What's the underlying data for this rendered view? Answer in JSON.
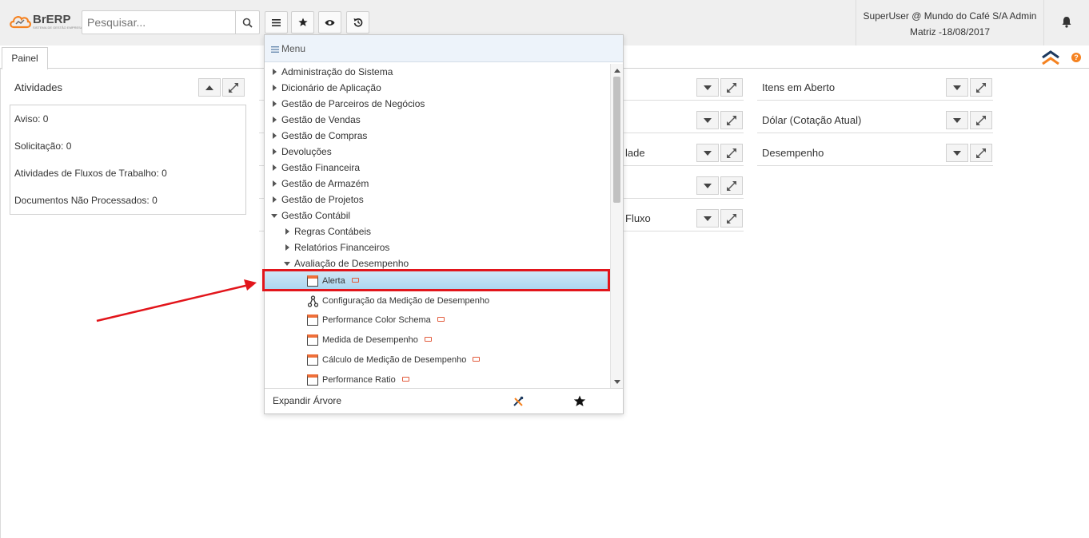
{
  "app": {
    "logo_text": "BrERP",
    "logo_subtitle": "SISTEMA DE GESTÃO EMPRESARIAL",
    "brand_color": "#f58220"
  },
  "search": {
    "placeholder": "Pesquisar..."
  },
  "toolbar": {
    "buttons": [
      {
        "icon": "menu-icon"
      },
      {
        "icon": "star-icon"
      },
      {
        "icon": "eye-icon"
      },
      {
        "icon": "history-icon"
      }
    ]
  },
  "user": {
    "line1": "SuperUser @ Mundo do Café S/A Admin",
    "line2": "Matriz -18/08/2017"
  },
  "tabs": [
    {
      "label": "Painel"
    }
  ],
  "dashboard": {
    "activities": {
      "title": "Atividades",
      "items": [
        "Aviso: 0",
        "Solicitação: 0",
        "Atividades de Fluxos de Trabalho: 0",
        "Documentos Não Processados: 0"
      ]
    },
    "middle_partial": [
      "lade",
      "Fluxo"
    ],
    "right_panels": [
      "Itens em Aberto",
      "Dólar (Cotação Atual)",
      "Desempenho"
    ]
  },
  "menu": {
    "header": "Menu",
    "tree": [
      {
        "label": "Administração do Sistema",
        "level": 0,
        "expanded": false
      },
      {
        "label": "Dicionário de Aplicação",
        "level": 0,
        "expanded": false
      },
      {
        "label": "Gestão de Parceiros de Negócios",
        "level": 0,
        "expanded": false
      },
      {
        "label": "Gestão de Vendas",
        "level": 0,
        "expanded": false
      },
      {
        "label": "Gestão de Compras",
        "level": 0,
        "expanded": false
      },
      {
        "label": "Devoluções",
        "level": 0,
        "expanded": false
      },
      {
        "label": "Gestão Financeira",
        "level": 0,
        "expanded": false
      },
      {
        "label": "Gestão de Armazém",
        "level": 0,
        "expanded": false
      },
      {
        "label": "Gestão de Projetos",
        "level": 0,
        "expanded": false
      },
      {
        "label": "Gestão Contábil",
        "level": 0,
        "expanded": true
      },
      {
        "label": "Regras Contábeis",
        "level": 1,
        "expanded": false
      },
      {
        "label": "Relatórios Financeiros",
        "level": 1,
        "expanded": false
      },
      {
        "label": "Avaliação de Desempenho",
        "level": 1,
        "expanded": true
      }
    ],
    "leaves": [
      {
        "label": "Alerta",
        "icon": "window-icon",
        "selected": true
      },
      {
        "label": "Configuração da Medição de Desempenho",
        "icon": "workflow-icon",
        "selected": false
      },
      {
        "label": "Performance Color Schema",
        "icon": "window-icon",
        "selected": false
      },
      {
        "label": "Medida de Desempenho",
        "icon": "window-icon",
        "selected": false
      },
      {
        "label": "Cálculo de Medição de Desempenho",
        "icon": "window-icon",
        "selected": false
      },
      {
        "label": "Performance Ratio",
        "icon": "window-icon",
        "selected": false
      }
    ],
    "footer_label": "Expandir Árvore"
  },
  "annotation": {
    "color": "#e2151b"
  }
}
